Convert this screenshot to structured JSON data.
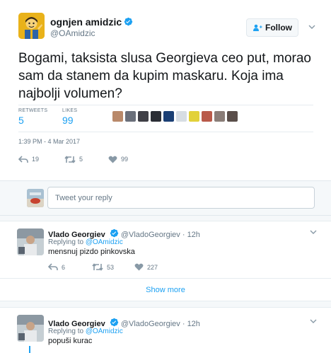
{
  "main_tweet": {
    "author_name": "ognjen amidzic",
    "author_handle": "@OAmidzic",
    "follow_label": "Follow",
    "text": "Bogami, taksista slusa Georgieva ceo put, morao sam da stanem da kupim maskaru. Koja ima najbolji volumen?",
    "retweets_label": "RETWEETS",
    "retweets_count": "5",
    "likes_label": "LIKES",
    "likes_count": "99",
    "timestamp": "1:39 PM - 4 Mar 2017",
    "actions": {
      "reply_count": "19",
      "retweet_count": "5",
      "like_count": "99"
    },
    "liker_colors": [
      "#b9896a",
      "#6a6f7a",
      "#3f3f46",
      "#2b2e35",
      "#1b3f74",
      "#d7dde3",
      "#e2d13a",
      "#b95a4a",
      "#8a7d78",
      "#5a4e4a"
    ]
  },
  "reply_box": {
    "placeholder": "Tweet your reply"
  },
  "replies": [
    {
      "name": "Vlado Georgiev",
      "handle": "@VladoGeorgiev",
      "time": "12h",
      "replying_prefix": "Replying to",
      "replying_to": "@OAmidzic",
      "text": "mensnuj pizdo pinkovska",
      "reply_count": "6",
      "retweet_count": "53",
      "like_count": "227"
    },
    {
      "name": "Vlado Georgiev",
      "handle": "@VladoGeorgiev",
      "time": "12h",
      "replying_prefix": "Replying to",
      "replying_to": "@OAmidzic",
      "text": "popuši kurac"
    }
  ],
  "show_more_label": "Show more",
  "colors": {
    "accent": "#1da1f2",
    "muted": "#657786",
    "text": "#14171a",
    "border": "#e6ecf0"
  }
}
